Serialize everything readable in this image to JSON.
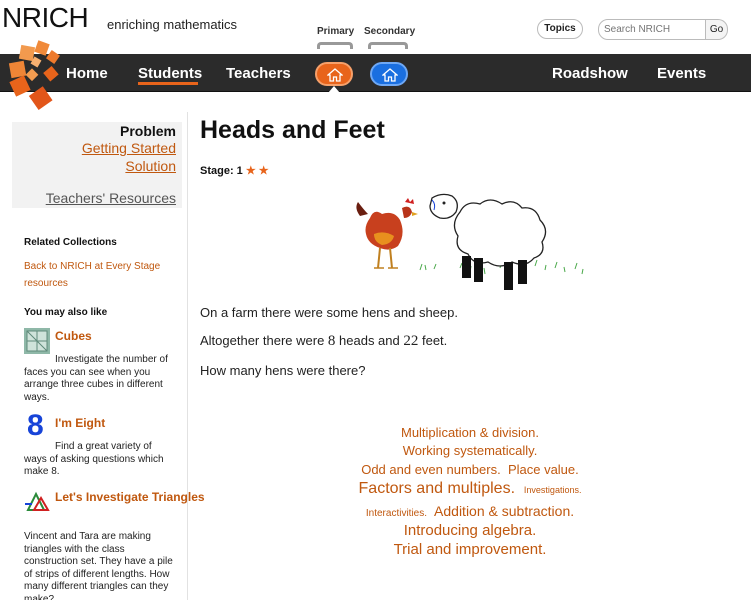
{
  "header": {
    "logo": "NRICH",
    "tagline": "enriching mathematics",
    "stage_primary": "Primary",
    "stage_secondary": "Secondary",
    "topics_label": "Topics",
    "search_placeholder": "Search NRICH",
    "go_label": "Go"
  },
  "nav": {
    "home": "Home",
    "students": "Students",
    "teachers": "Teachers",
    "roadshow": "Roadshow",
    "events": "Events",
    "active": "Students",
    "accent": "#e8641b",
    "secondary_color": "#1a6fe0"
  },
  "sidebar": {
    "problem": "Problem",
    "getting_started": "Getting Started",
    "solution": "Solution",
    "teachers_resources": "Teachers' Resources",
    "related_heading": "Related Collections",
    "related_link": "Back to NRICH at Every Stage resources",
    "also_like_heading": "You may also like",
    "items": [
      {
        "title": "Cubes",
        "desc": "Investigate the number of faces you can see when you arrange three cubes in different ways.",
        "icon": "cubes-icon"
      },
      {
        "title": "I'm Eight",
        "desc": "Find a great variety of ways of asking questions which make 8.",
        "icon": "eight-icon",
        "icon_text": "8"
      },
      {
        "title": "Let's Investigate Triangles",
        "desc": "Vincent and Tara are making triangles with the class construction set. They have a pile of strips of different lengths. How many different triangles can they make?",
        "icon": "triangles-icon"
      }
    ]
  },
  "main": {
    "title": "Heads and Feet",
    "stage_label": "Stage: 1",
    "stars": "★ ★",
    "para1": "On a farm there were some hens and sheep.",
    "para2_a": "Altogether there were ",
    "para2_n1": "8",
    "para2_b": " heads and ",
    "para2_n2": "22",
    "para2_c": " feet.",
    "para3": "How many hens were there?"
  },
  "tags": {
    "t1": "Multiplication & division",
    "t2": "Working systematically",
    "t3": "Odd and even numbers",
    "t4": "Place value",
    "t5": "Factors and multiples",
    "t6": "Investigations",
    "t7": "Interactivities",
    "t8": "Addition & subtraction",
    "t9": "Introducing algebra",
    "t10": "Trial and improvement",
    "dot": "."
  }
}
